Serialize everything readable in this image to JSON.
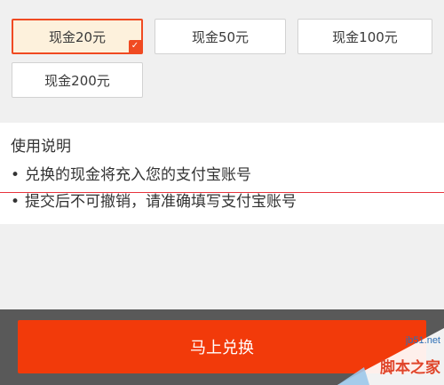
{
  "options": [
    {
      "label": "现金20元",
      "selected": true
    },
    {
      "label": "现金50元",
      "selected": false
    },
    {
      "label": "现金100元",
      "selected": false
    },
    {
      "label": "现金200元",
      "selected": false
    }
  ],
  "check_glyph": "✓",
  "notes": {
    "title": "使用说明",
    "bullet": "•",
    "lines": [
      "兑换的现金将充入您的支付宝账号",
      "提交后不可撤销，请准确填写支付宝账号"
    ]
  },
  "exchange_label": "马上兑换",
  "watermark": {
    "site": "jb51.net",
    "name": "脚本之家"
  },
  "colors": {
    "accent": "#f04a22",
    "button": "#f23a0a",
    "selected_bg": "#fdf1dc",
    "bottom_bar": "#595959",
    "rule": "#e8343c"
  },
  "icons": {
    "check": "check-icon"
  }
}
